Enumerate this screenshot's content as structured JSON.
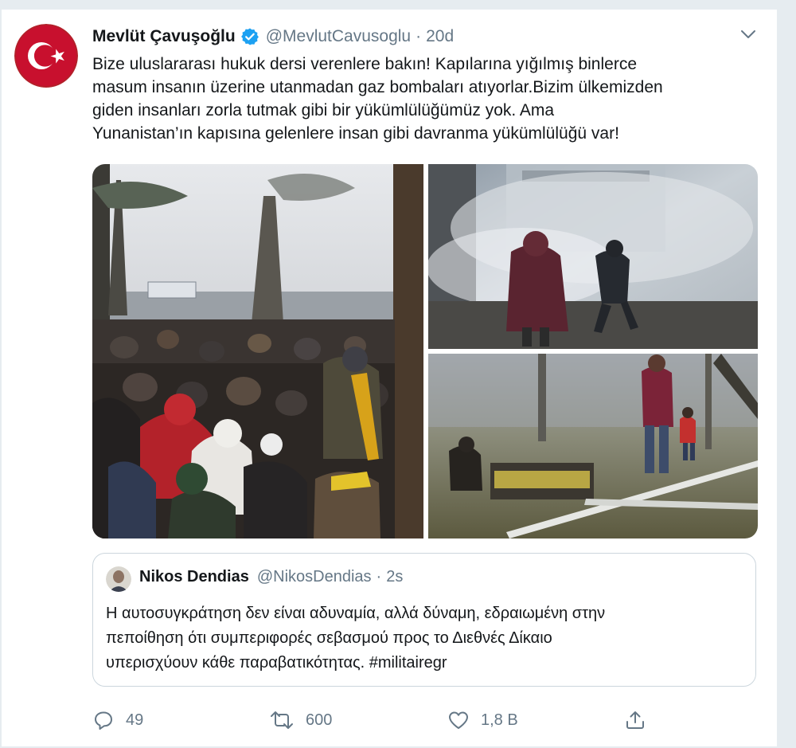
{
  "tweet": {
    "author_name": "Mevlüt Çavuşoğlu",
    "author_handle": "@MevlutCavusoglu",
    "separator": "·",
    "time": "20d",
    "text_lines": [
      "Bize uluslararası hukuk dersi verenlere bakın! Kapılarına yığılmış binlerce",
      "masum insanın üzerine utanmadan gaz bombaları atıyorlar.Bizim ülkemizden",
      "giden insanları zorla tutmak gibi bir yükümlülüğümüz yok. Ama",
      "Yunanistan’ın kapısına gelenlere insan gibi davranma yükümlülüğü var!"
    ]
  },
  "quote": {
    "author_name": "Nikos Dendias",
    "author_handle": "@NikosDendias",
    "separator": "·",
    "time": "2s",
    "text_lines": [
      "Η αυτοσυγκράτηση δεν είναι αδυναμία, αλλά δύναμη, εδραιωμένη στην",
      "πεποίθηση ότι συμπεριφορές σεβασμού προς το Διεθνές Δίκαιο",
      "υπερισχύουν κάθε παραβατικότητας. #militairegr"
    ]
  },
  "actions": {
    "reply_count": "49",
    "retweet_count": "600",
    "like_count": "1,8 B"
  },
  "icons": {
    "verified": "verified-badge-icon",
    "caret": "chevron-down-icon",
    "reply": "reply-icon",
    "retweet": "retweet-icon",
    "like": "like-icon",
    "share": "share-icon"
  },
  "colors": {
    "accent": "#1da1f2",
    "muted": "#657786",
    "text": "#14171a",
    "border": "#ccd6dd",
    "flag_red": "#c8102e"
  }
}
